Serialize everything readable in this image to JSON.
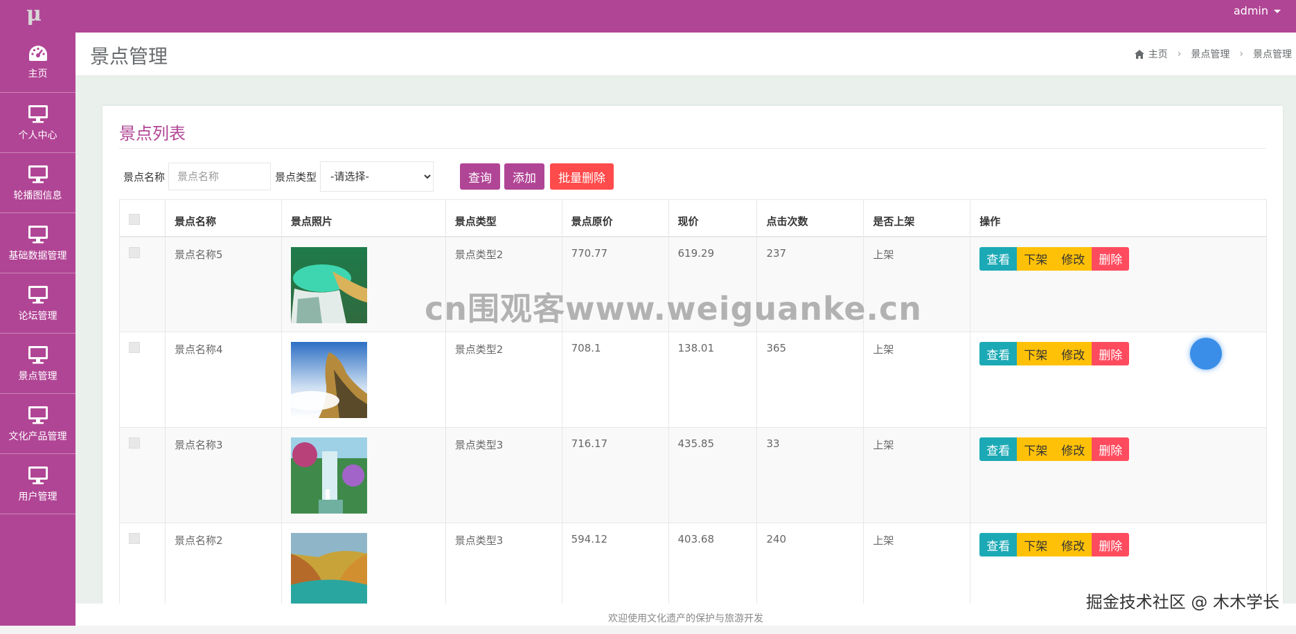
{
  "app": {
    "logo_glyph": "μ",
    "user": "admin"
  },
  "sidebar": {
    "items": [
      {
        "label": "主页",
        "icon": "dashboard-icon"
      },
      {
        "label": "个人中心",
        "icon": "monitor-icon"
      },
      {
        "label": "轮播图信息",
        "icon": "monitor-icon"
      },
      {
        "label": "基础数据管理",
        "icon": "monitor-icon"
      },
      {
        "label": "论坛管理",
        "icon": "monitor-icon"
      },
      {
        "label": "景点管理",
        "icon": "monitor-icon"
      },
      {
        "label": "文化产品管理",
        "icon": "monitor-icon"
      },
      {
        "label": "用户管理",
        "icon": "monitor-icon"
      }
    ]
  },
  "header": {
    "title": "景点管理",
    "breadcrumb": [
      "主页",
      "景点管理",
      "景点管理"
    ]
  },
  "panel": {
    "title": "景点列表"
  },
  "search": {
    "name_label": "景点名称",
    "name_placeholder": "景点名称",
    "type_label": "景点类型",
    "type_selected": "-请选择-",
    "query_label": "查询",
    "add_label": "添加",
    "batch_delete_label": "批量删除"
  },
  "table": {
    "headers": [
      "景点名称",
      "景点照片",
      "景点类型",
      "景点原价",
      "现价",
      "点击次数",
      "是否上架",
      "操作"
    ],
    "rows": [
      {
        "name": "景点名称5",
        "type": "景点类型2",
        "orig_price": "770.77",
        "price": "619.29",
        "clicks": "237",
        "status": "上架",
        "photo": "turquoise-pool-photo"
      },
      {
        "name": "景点名称4",
        "type": "景点类型2",
        "orig_price": "708.1",
        "price": "138.01",
        "clicks": "365",
        "status": "上架",
        "photo": "mountain-cloud-photo"
      },
      {
        "name": "景点名称3",
        "type": "景点类型3",
        "orig_price": "716.17",
        "price": "435.85",
        "clicks": "33",
        "status": "上架",
        "photo": "waterfall-photo"
      },
      {
        "name": "景点名称2",
        "type": "景点类型3",
        "orig_price": "594.12",
        "price": "403.68",
        "clicks": "240",
        "status": "上架",
        "photo": "autumn-lake-photo"
      }
    ],
    "actions": {
      "view": "查看",
      "unlist": "下架",
      "edit": "修改",
      "delete": "删除"
    }
  },
  "footer": {
    "text": "欢迎使用文化遗产的保护与旅游开发"
  },
  "watermarks": {
    "center": "cn围观客www.weiguanke.cn",
    "corner": "掘金技术社区 @ 木木学长"
  },
  "colors": {
    "brand": "#b14595",
    "danger": "#ff4b4b",
    "warning": "#ffc107",
    "info": "#1ba9b5"
  }
}
